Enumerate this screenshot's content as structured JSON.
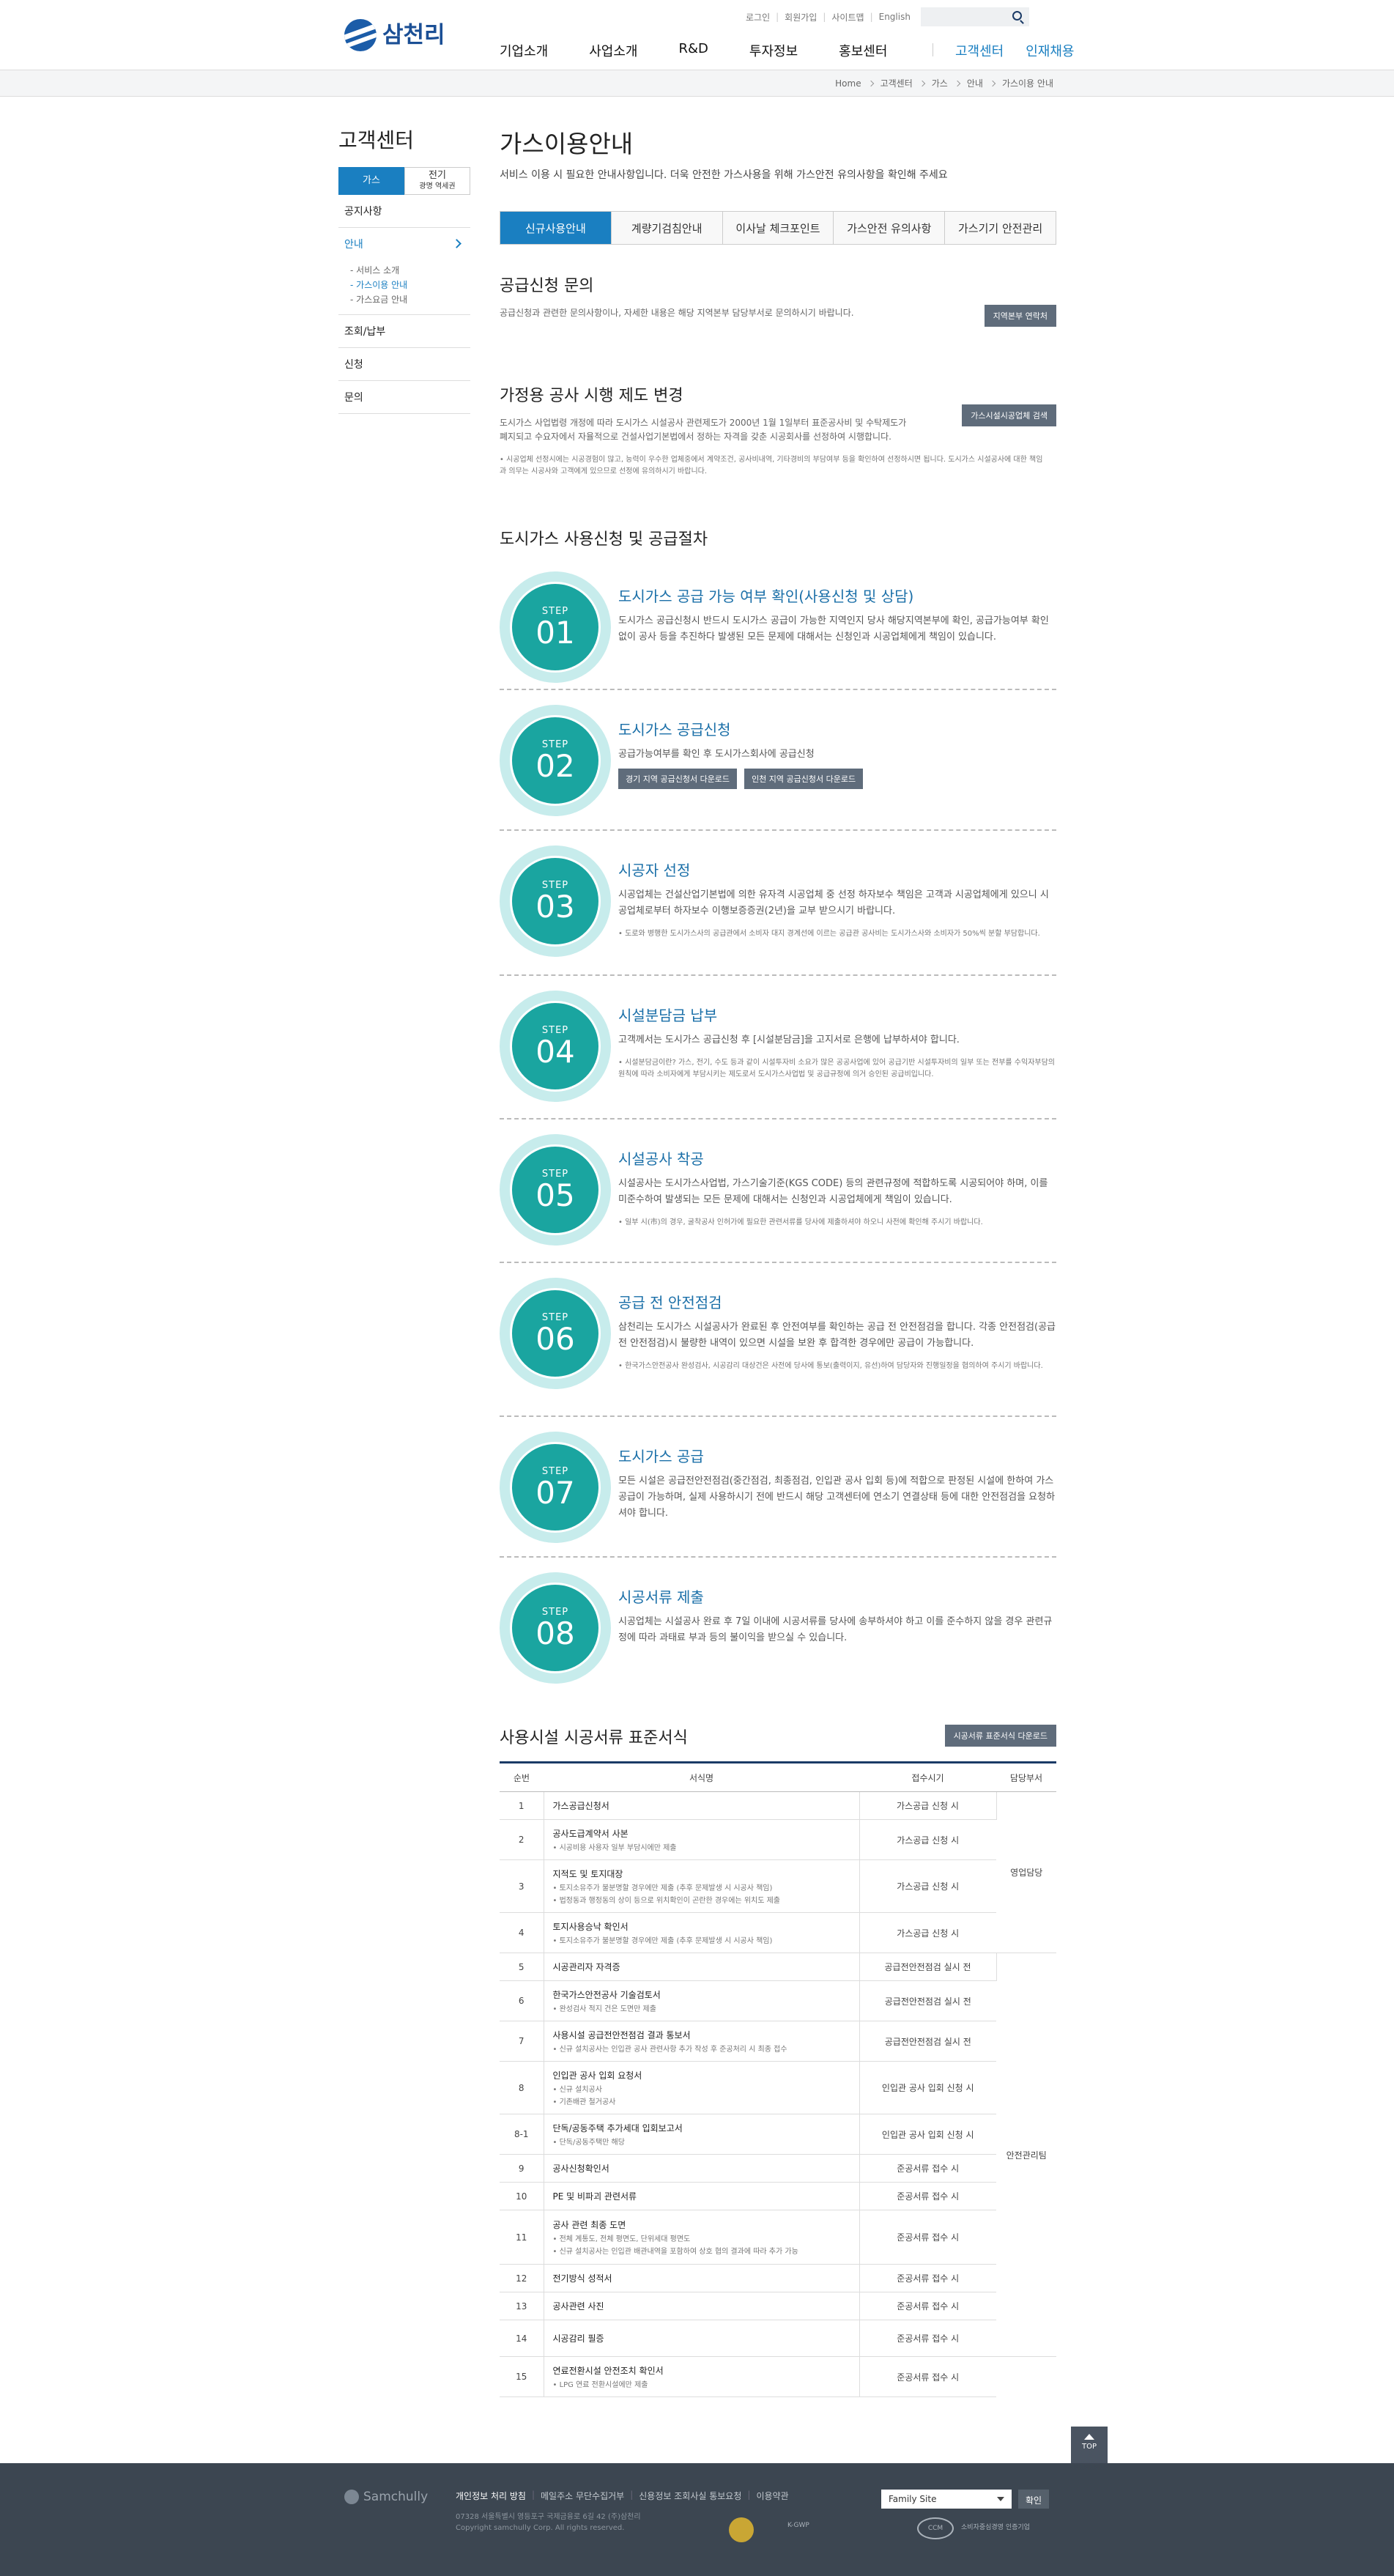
{
  "header": {
    "logo_text": "삼천리",
    "util": [
      "로그인",
      "회원가입",
      "사이트맵",
      "English"
    ],
    "gnb": [
      "기업소개",
      "사업소개",
      "R&D",
      "투자정보",
      "홍보센터"
    ],
    "gnb_right": [
      "고객센터",
      "인재채용"
    ],
    "colors": {
      "brand": "#1b4f95",
      "accent": "#1a7fc1",
      "teal": "#1aa5a0"
    }
  },
  "breadcrumb": [
    "Home",
    "고객센터",
    "가스",
    "안내",
    "가스이용 안내"
  ],
  "side": {
    "title": "고객센터",
    "tabs": [
      "가스",
      "전기",
      "광명 역세권"
    ],
    "menu": [
      "공지사항",
      "안내",
      "조회/납부",
      "신청",
      "문의"
    ],
    "submenu": [
      "서비스 소개",
      "가스이용 안내",
      "가스요금 안내"
    ]
  },
  "page": {
    "title": "가스이용안내",
    "lead": "서비스 이용 시 필요한 안내사항입니다. 더욱 안전한 가스사용을 위해 가스안전 유의사항을 확인해 주세요",
    "tabs": [
      "신규사용안내",
      "계량기검침안내",
      "이사날 체크포인트",
      "가스안전 유의사항",
      "가스기기 안전관리"
    ]
  },
  "supply_inquiry": {
    "title": "공급신청 문의",
    "text": "공급신청과 관련한 문의사항이나, 자세한 내용은 해당 지역본부 담당부서로 문의하시기 바랍니다.",
    "button": "지역본부 연락처"
  },
  "system": {
    "title": "가정용 공사 시행 제도 변경",
    "text": "도시가스 사업법령 개정에 따라 도시가스 시설공사 관련제도가 2000년 1월 1일부터 표준공사비 및 수탁제도가 폐지되고 수요자에서 자율적으로 건설사업기본법에서 정하는 자격을 갖춘 시공회사를 선정하여 시행합니다.",
    "button": "가스시설시공업체 검색",
    "note": "시공업체 선정시에는 시공경험이 많고, 능력이 우수한 업체중에서 계약조건, 공사비내역, 기타경비의 부담여부 등을 확인하여 선정하시면 됩니다. 도시가스 시설공사에 대한 책임과 의무는 시공사와 고객에게 있으므로 선정에 유의하시기 바랍니다."
  },
  "procedure": {
    "title": "도시가스 사용신청 및 공급절차",
    "step_label": "STEP",
    "steps": [
      {
        "num": "01",
        "title": "도시가스 공급 가능 여부 확인(사용신청 및 상담)",
        "text": "도시가스 공급신청시 반드시 도시가스 공급이 가능한 지역인지 당사 해당지역본부에 확인, 공급가능여부 확인 없이 공사 등을 추진하다 발생된 모든 문제에 대해서는 신청인과 시공업체에게 책임이 있습니다."
      },
      {
        "num": "02",
        "title": "도시가스 공급신청",
        "text": "공급가능여부를 확인 후 도시가스회사에 공급신청",
        "buttons": [
          "경기 지역 공급신청서 다운로드",
          "인천 지역 공급신청서 다운로드"
        ]
      },
      {
        "num": "03",
        "title": "시공자 선정",
        "text": "시공업체는 건설산업기본법에 의한 유자격 시공업체 중 선정 하자보수 책임은 고객과 시공업체에게 있으니 시공업체로부터 하자보수 이행보증증권(2년)을 교부 받으시기 바랍니다.",
        "note": "도로와 병행한 도시가스사의 공급관에서 소비자 대지 경계선에 이르는 공급관 공사비는 도시가스사와 소비자가 50%씩 분할 부담합니다."
      },
      {
        "num": "04",
        "title": "시설분담금 납부",
        "text": "고객께서는 도시가스 공급신청 후 [시설분담금]을 고지서로 은행에 납부하셔야 합니다.",
        "note": "시설분담금이란? 가스, 전기, 수도 등과 같이 시설투자비 소요가 많은 공공사업에 있어 공급기반 시설투자비의 일부 또는 전부를 수익자부담의 원칙에 따라 소비자에게 부담시키는 제도로서 도시가스사업법 및 공급규정에 의거 승인된 공급비입니다."
      },
      {
        "num": "05",
        "title": "시설공사 착공",
        "text": "시설공사는 도시가스사업법, 가스기술기준(KGS CODE) 등의 관련규정에 적합하도록 시공되어야 하며, 이를 미준수하여 발생되는 모든 문제에 대해서는 신청인과 시공업체에게 책임이 있습니다.",
        "note": "일부 시(市)의 경우, 굴착공사 인허가에 필요한 관련서류를 당사에 제출하셔야 하오니 사전에 확인해 주시기 바랍니다."
      },
      {
        "num": "06",
        "title": "공급 전 안전점검",
        "text": "삼천리는 도시가스 시설공사가 완료된 후 안전여부를 확인하는 공급 전 안전점검을 합니다. 각종 안전점검(공급전 안전점검)시 불량한 내역이 있으면 시설을 보완 후 합격한 경우에만 공급이 가능합니다.",
        "note": "한국가스안전공사 완성검사, 시공감리 대상건은 사전에 당사에 통보(출력이지, 유선)하여 담당자와 진행일정을 협의하여 주시기 바랍니다."
      },
      {
        "num": "07",
        "title": "도시가스 공급",
        "text": "모든 시설은 공급전안전점검(중간점검, 최종점검, 인입관 공사 입회 등)에 적합으로 판정된 시설에 한하여 가스공급이 가능하며, 실제 사용하시기 전에 반드시 해당 고객센터에 연소기 연결상태 등에 대한 안전점검을 요청하셔야 합니다."
      },
      {
        "num": "08",
        "title": "시공서류 제출",
        "text": "시공업체는 시설공사 완료 후 7일 이내에 시공서류를 당사에 송부하셔야 하고 이를 준수하지 않을 경우 관련규정에 따라 과태료 부과 등의 불이익을 받으실 수 있습니다."
      }
    ]
  },
  "forms": {
    "title": "사용시설 시공서류 표준서식",
    "button": "시공서류 표준서식 다운로드",
    "headers": [
      "순번",
      "서식명",
      "접수시기",
      "담당부서"
    ],
    "dept": [
      "영업담당",
      "안전관리팀"
    ],
    "rows": [
      {
        "no": "1",
        "name": "가스공급신청서",
        "subs": [],
        "time": "가스공급 신청 시"
      },
      {
        "no": "2",
        "name": "공사도급계약서 사본",
        "subs": [
          "시공비용 사용자 일부 부담시에만 제출"
        ],
        "time": "가스공급 신청 시"
      },
      {
        "no": "3",
        "name": "지적도 및 토지대장",
        "subs": [
          "토지소유주가 불분명할 경우에만 제출 (추후 문제발생 시 시공사 책임)",
          "법정동과 행정동의 상이 등으로 위치확인이 곤란한 경우에는 위치도 제출"
        ],
        "time": "가스공급 신청 시"
      },
      {
        "no": "4",
        "name": "토지사용승낙 확인서",
        "subs": [
          "토지소유주가 불분명할 경우에만 제출 (추후 문제발생 시 시공사 책임)"
        ],
        "time": "가스공급 신청 시"
      },
      {
        "no": "5",
        "name": "시공관리자 자격증",
        "subs": [],
        "time": "공급전안전점검 실시 전"
      },
      {
        "no": "6",
        "name": "한국가스안전공사 기술검토서",
        "subs": [
          "완성검사 적지 건은 도면만 제출"
        ],
        "time": "공급전안전점검 실시 전"
      },
      {
        "no": "7",
        "name": "사용시설 공급전안전점검 결과 통보서",
        "subs": [
          "신규 설치공사는 인입관 공사 관련사항 추가 작성 후 준공처리 시 최종 접수"
        ],
        "time": "공급전안전점검 실시 전"
      },
      {
        "no": "8",
        "name": "인입관 공사 입회 요청서",
        "subs": [
          "신규 설치공사",
          "기존배관 철거공사"
        ],
        "time": "인입관 공사 입회 신청 시"
      },
      {
        "no": "8-1",
        "name": "단독/공동주택 추가세대 입회보고서",
        "subs": [
          "단독/공동주택만 해당"
        ],
        "time": "인입관 공사 입회 신청 시"
      },
      {
        "no": "9",
        "name": "공사신청확인서",
        "subs": [],
        "time": "준공서류 접수 시"
      },
      {
        "no": "10",
        "name": "PE 및 비파괴 관련서류",
        "subs": [],
        "time": "준공서류 접수 시"
      },
      {
        "no": "11",
        "name": "공사 관련 최종 도면",
        "subs": [
          "전체 계통도, 전체 평면도, 단위세대 평면도",
          "신규 설치공사는 인입관 배관내역을 포함하여 상호 협의 결과에 따라 추가 가능"
        ],
        "time": "준공서류 접수 시"
      },
      {
        "no": "12",
        "name": "전기방식 성적서",
        "subs": [],
        "time": "준공서류 접수 시"
      },
      {
        "no": "13",
        "name": "공사관련 사진",
        "subs": [],
        "time": "준공서류 접수 시"
      },
      {
        "no": "14",
        "name": "시공감리 필증",
        "subs": [],
        "time": "준공서류 접수 시"
      },
      {
        "no": "15",
        "name": "연료전환시설 안전조치 확인서",
        "subs": [
          "LPG 연료 전환시설에만 제출"
        ],
        "time": "준공서류 접수 시"
      }
    ]
  },
  "top_button": "TOP",
  "footer": {
    "logo": "Samchully",
    "links": [
      "개인정보 처리 방침",
      "메일주소 무단수집거부",
      "신용정보 조회사실 통보요청",
      "이용약관"
    ],
    "address": "07328 서울특별시 영등포구 국제금융로 6길 42 (주)삼천리",
    "copyright": "Copyright samchully Corp. All rights reserved.",
    "family_site": "Family Site",
    "confirm": "확인",
    "badges": [
      "K-GWP",
      "CCM",
      "소비자중심경영 인증기업"
    ]
  }
}
